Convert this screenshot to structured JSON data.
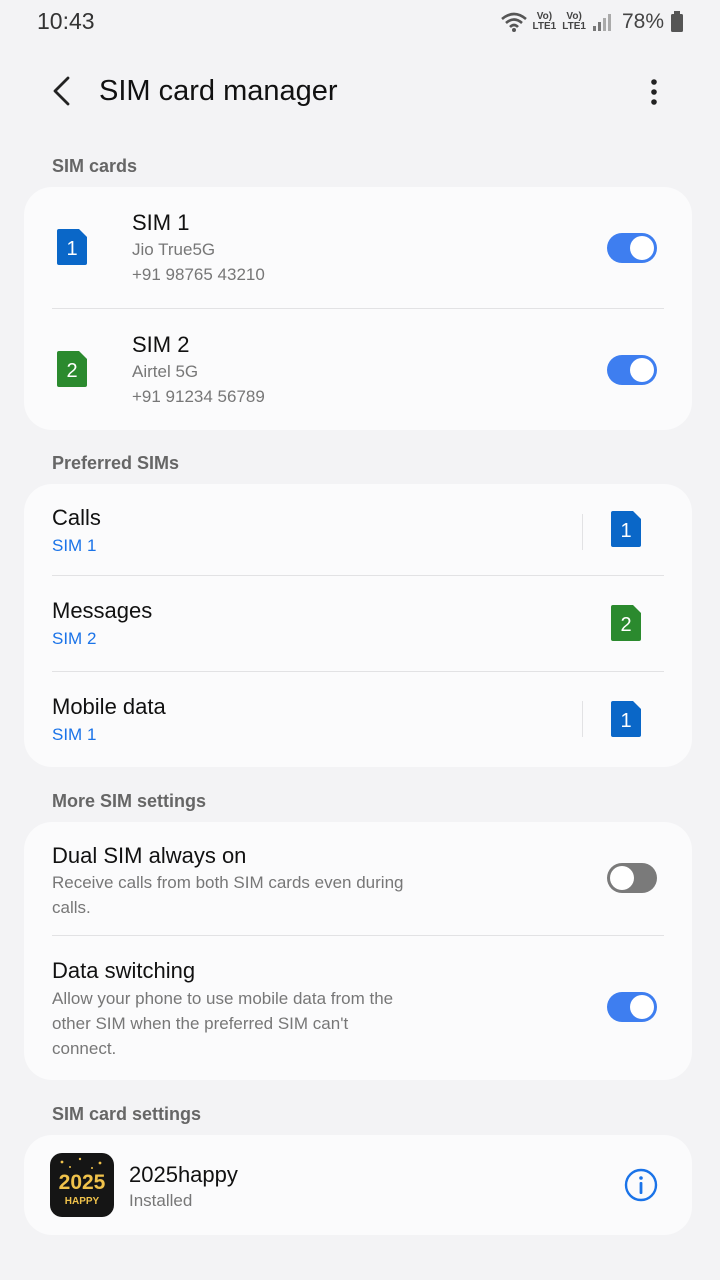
{
  "status_bar": {
    "time": "10:43",
    "volte1_top": "Vo)",
    "volte1_bottom": "LTE1",
    "volte2_top": "Vo)",
    "volte2_bottom": "LTE1",
    "battery": "78%"
  },
  "appbar": {
    "title": "SIM card manager"
  },
  "sim_cards": {
    "label": "SIM cards",
    "items": [
      {
        "name": "SIM 1",
        "carrier": "Jio True5G",
        "number": "+91 98765 43210",
        "badge": "1",
        "badge_color": "#0a67c8",
        "enabled": true
      },
      {
        "name": "SIM 2",
        "carrier": "Airtel 5G",
        "number": "+91 91234 56789",
        "badge": "2",
        "badge_color": "#2b8a2e",
        "enabled": true
      }
    ]
  },
  "preferred": {
    "label": "Preferred SIMs",
    "items": [
      {
        "name": "Calls",
        "value": "SIM 1",
        "badge": "1"
      },
      {
        "name": "Messages",
        "value": "SIM 2",
        "badge": "2"
      },
      {
        "name": "Mobile data",
        "value": "SIM 1",
        "badge": "1"
      }
    ]
  },
  "more": {
    "label": "More SIM settings",
    "items": [
      {
        "name": "Dual SIM always on",
        "desc": "Receive calls from both SIM cards even during calls.",
        "enabled": false
      },
      {
        "name": "Data switching",
        "desc": "Allow your phone to use mobile data from the other SIM when the preferred SIM can't connect.",
        "enabled": true
      }
    ]
  },
  "sim_settings": {
    "label": "SIM card settings",
    "app_name": "2025happy",
    "app_status": "Installed",
    "icon_year": "2025",
    "icon_text": "HAPPY"
  },
  "colors": {
    "accent": "#3e7ef0",
    "link_blue": "#1a73e8",
    "sim1": "#0a67c8",
    "sim2": "#2b8a2e"
  },
  "icons": [
    "wifi-icon",
    "signal-icon",
    "battery-icon",
    "back-arrow-icon",
    "more-vert-icon",
    "sim1-icon",
    "sim2-icon",
    "info-icon"
  ]
}
